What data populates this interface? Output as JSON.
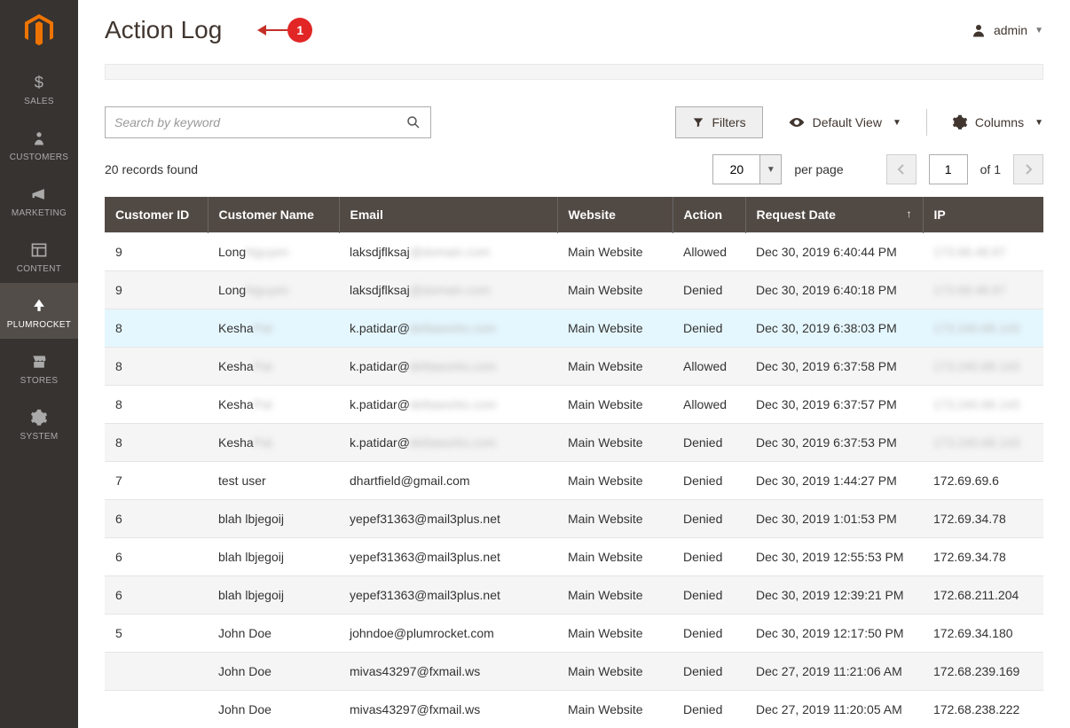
{
  "sidebar": {
    "items": [
      {
        "label": "SALES"
      },
      {
        "label": "CUSTOMERS"
      },
      {
        "label": "MARKETING"
      },
      {
        "label": "CONTENT"
      },
      {
        "label": "PLUMROCKET"
      },
      {
        "label": "STORES"
      },
      {
        "label": "SYSTEM"
      }
    ]
  },
  "header": {
    "title": "Action Log",
    "callout_number": "1",
    "user_label": "admin"
  },
  "toolbar": {
    "search_placeholder": "Search by keyword",
    "filters_label": "Filters",
    "default_view_label": "Default View",
    "columns_label": "Columns"
  },
  "pager": {
    "records_found": "20 records found",
    "page_size": "20",
    "per_page_label": "per page",
    "page_number": "1",
    "of_label": "of 1"
  },
  "table": {
    "columns": [
      "Customer ID",
      "Customer Name",
      "Email",
      "Website",
      "Action",
      "Request Date",
      "IP"
    ],
    "sorted_column": "Request Date",
    "sort_dir": "asc",
    "rows": [
      {
        "id": "9",
        "name_prefix": "Long ",
        "name_blur": "Nguyen",
        "email_prefix": "laksdjflksaj",
        "email_blur": "@domain.com",
        "website": "Main Website",
        "action": "Allowed",
        "date": "Dec 30, 2019 6:40:44 PM",
        "ip_blur": "173.68.48.87"
      },
      {
        "id": "9",
        "name_prefix": "Long ",
        "name_blur": "Nguyen",
        "email_prefix": "laksdjflksaj",
        "email_blur": "@domain.com",
        "website": "Main Website",
        "action": "Denied",
        "date": "Dec 30, 2019 6:40:18 PM",
        "ip_blur": "173.68.48.87"
      },
      {
        "id": "8",
        "name_prefix": "Kesha",
        "name_blur": " Pat",
        "email_prefix": "k.patidar@",
        "email_blur": "deltaworks.com",
        "website": "Main Website",
        "action": "Denied",
        "date": "Dec 30, 2019 6:38:03 PM",
        "ip_blur": "173.240.68.143",
        "highlight": true
      },
      {
        "id": "8",
        "name_prefix": "Kesha",
        "name_blur": " Pat",
        "email_prefix": "k.patidar@",
        "email_blur": "deltaworks.com",
        "website": "Main Website",
        "action": "Allowed",
        "date": "Dec 30, 2019 6:37:58 PM",
        "ip_blur": "173.240.68.143"
      },
      {
        "id": "8",
        "name_prefix": "Kesha",
        "name_blur": " Pat",
        "email_prefix": "k.patidar@",
        "email_blur": "deltaworks.com",
        "website": "Main Website",
        "action": "Allowed",
        "date": "Dec 30, 2019 6:37:57 PM",
        "ip_blur": "173.240.68.143"
      },
      {
        "id": "8",
        "name_prefix": "Kesha",
        "name_blur": " Pat",
        "email_prefix": "k.patidar@",
        "email_blur": "deltaworks.com",
        "website": "Main Website",
        "action": "Denied",
        "date": "Dec 30, 2019 6:37:53 PM",
        "ip_blur": "173.240.68.143"
      },
      {
        "id": "7",
        "name": "test user",
        "email": "dhartfield@gmail.com",
        "website": "Main Website",
        "action": "Denied",
        "date": "Dec 30, 2019 1:44:27 PM",
        "ip": "172.69.69.6"
      },
      {
        "id": "6",
        "name": "blah lbjegoij",
        "email": "yepef31363@mail3plus.net",
        "website": "Main Website",
        "action": "Denied",
        "date": "Dec 30, 2019 1:01:53 PM",
        "ip": "172.69.34.78"
      },
      {
        "id": "6",
        "name": "blah lbjegoij",
        "email": "yepef31363@mail3plus.net",
        "website": "Main Website",
        "action": "Denied",
        "date": "Dec 30, 2019 12:55:53 PM",
        "ip": "172.69.34.78"
      },
      {
        "id": "6",
        "name": "blah lbjegoij",
        "email": "yepef31363@mail3plus.net",
        "website": "Main Website",
        "action": "Denied",
        "date": "Dec 30, 2019 12:39:21 PM",
        "ip": "172.68.211.204"
      },
      {
        "id": "5",
        "name": "John Doe",
        "email": "johndoe@plumrocket.com",
        "website": "Main Website",
        "action": "Denied",
        "date": "Dec 30, 2019 12:17:50 PM",
        "ip": "172.69.34.180"
      },
      {
        "id": "",
        "name": "John Doe",
        "email": "mivas43297@fxmail.ws",
        "website": "Main Website",
        "action": "Denied",
        "date": "Dec 27, 2019 11:21:06 AM",
        "ip": "172.68.239.169"
      },
      {
        "id": "",
        "name": "John Doe",
        "email": "mivas43297@fxmail.ws",
        "website": "Main Website",
        "action": "Denied",
        "date": "Dec 27, 2019 11:20:05 AM",
        "ip": "172.68.238.222"
      }
    ]
  }
}
